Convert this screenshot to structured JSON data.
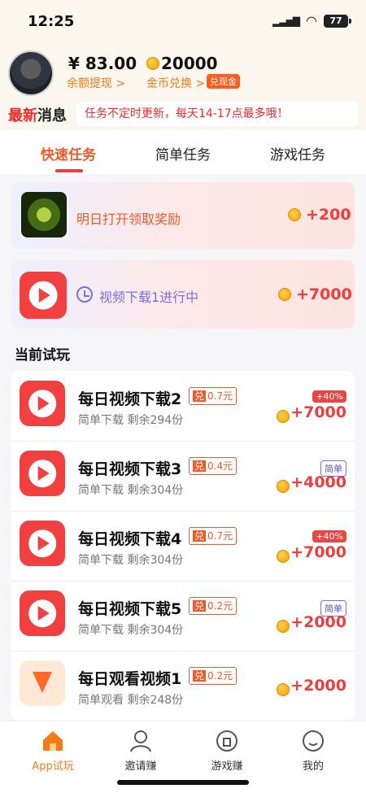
{
  "status": {
    "time": "12:25",
    "battery": "77"
  },
  "account": {
    "balance": "¥ 83.00",
    "withdraw_label": "余额提现 >",
    "coins": "20000",
    "exchange_label": "金币兑换 >",
    "exchange_badge": "兑现金"
  },
  "news": {
    "title_red": "最新",
    "title_black": "消息",
    "text": "任务不定时更新，每天14-17点最多哦！"
  },
  "tabs": [
    {
      "label": "快速任务"
    },
    {
      "label": "简单任务"
    },
    {
      "label": "游戏任务"
    }
  ],
  "cards": [
    {
      "text": "明日打开领取奖励",
      "reward": "+200"
    },
    {
      "text": "视频下载1进行中",
      "reward": "+7000"
    }
  ],
  "section_title": "当前试玩",
  "tasks": [
    {
      "name": "每日视频下载2",
      "badge_k": "兑",
      "badge_v": "0.7元",
      "sub": "简单下载  剩余294份",
      "tag": "+40%",
      "reward": "+7000"
    },
    {
      "name": "每日视频下载3",
      "badge_k": "兑",
      "badge_v": "0.4元",
      "sub": "简单下载  剩余304份",
      "tag": "简单",
      "reward": "+4000"
    },
    {
      "name": "每日视频下载4",
      "badge_k": "兑",
      "badge_v": "0.7元",
      "sub": "简单下载  剩余304份",
      "tag": "+40%",
      "reward": "+7000"
    },
    {
      "name": "每日视频下载5",
      "badge_k": "兑",
      "badge_v": "0.2元",
      "sub": "简单下载  剩余304份",
      "tag": "简单",
      "reward": "+2000"
    },
    {
      "name": "每日观看视频1",
      "badge_k": "兑",
      "badge_v": "0.2元",
      "sub": "简单观看  剩余248份",
      "reward": "+2000"
    }
  ],
  "nav": [
    {
      "label": "App试玩"
    },
    {
      "label": "邀请赚"
    },
    {
      "label": "游戏赚"
    },
    {
      "label": "我的"
    }
  ],
  "colors": {
    "accent": "#f03c3c",
    "orange": "#f07c1e",
    "purple": "#7a6fe6"
  }
}
